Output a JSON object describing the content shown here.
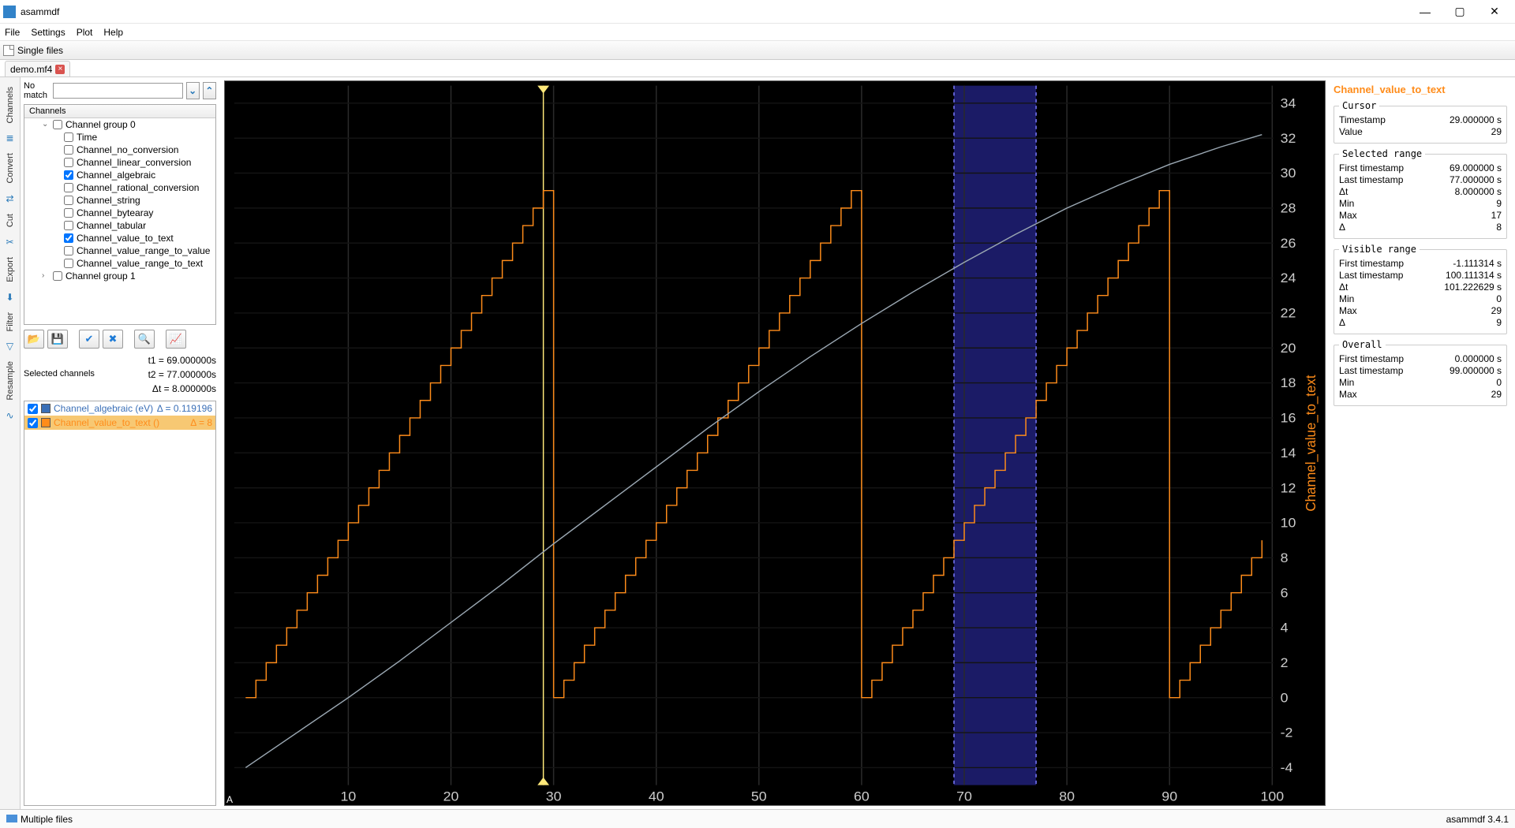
{
  "window": {
    "title": "asammdf"
  },
  "menu": [
    "File",
    "Settings",
    "Plot",
    "Help"
  ],
  "filetab": {
    "label": "Single files"
  },
  "doctab": {
    "label": "demo.mf4"
  },
  "sidetabs": [
    "Channels",
    "Convert",
    "Cut",
    "Export",
    "Filter",
    "Resample"
  ],
  "search": {
    "nomatch": "No match",
    "value": ""
  },
  "tree": {
    "header": "Channels",
    "group0": {
      "label": "Channel group 0",
      "items": [
        {
          "label": "Time",
          "checked": false
        },
        {
          "label": "Channel_no_conversion",
          "checked": false
        },
        {
          "label": "Channel_linear_conversion",
          "checked": false
        },
        {
          "label": "Channel_algebraic",
          "checked": true
        },
        {
          "label": "Channel_rational_conversion",
          "checked": false
        },
        {
          "label": "Channel_string",
          "checked": false
        },
        {
          "label": "Channel_bytearay",
          "checked": false
        },
        {
          "label": "Channel_tabular",
          "checked": false
        },
        {
          "label": "Channel_value_to_text",
          "checked": true
        },
        {
          "label": "Channel_value_range_to_value",
          "checked": false
        },
        {
          "label": "Channel_value_range_to_text",
          "checked": false
        }
      ]
    },
    "group1": {
      "label": "Channel group 1"
    }
  },
  "timestats": {
    "t1": "t1 = 69.000000s",
    "t2": "t2 = 77.000000s",
    "dt": "Δt = 8.000000s"
  },
  "selch_label": "Selected channels",
  "selected_channels": [
    {
      "name": "Channel_algebraic (eV)",
      "color": "#3a6fb7",
      "delta": "Δ = 0.119196",
      "textcolor": "#3a6fb7",
      "hl": false
    },
    {
      "name": "Channel_value_to_text ()",
      "color": "#ff8c1a",
      "delta": "Δ = 8",
      "textcolor": "#ff8c1a",
      "hl": true
    }
  ],
  "right": {
    "channel_name": "Channel_value_to_text",
    "cursor": {
      "Timestamp": "29.000000 s",
      "Value": "29"
    },
    "selected_range": {
      "First timestamp": "69.000000 s",
      "Last timestamp": "77.000000 s",
      "Δt": "8.000000 s",
      "Min": "9",
      "Max": "17",
      "Δ": "8"
    },
    "visible_range": {
      "First timestamp": "-1.111314 s",
      "Last timestamp": "100.111314 s",
      "Δt": "101.222629 s",
      "Min": "0",
      "Max": "29",
      "Δ": "9"
    },
    "overall": {
      "First timestamp": "0.000000 s",
      "Last timestamp": "99.000000 s",
      "Min": "0",
      "Max": "29"
    }
  },
  "statusbar": {
    "left": "Multiple files",
    "right": "asammdf 3.4.1"
  },
  "chart_data": {
    "type": "line",
    "title": "",
    "xlabel": "",
    "ylabel": "",
    "xlim": [
      -1.111314,
      100.111314
    ],
    "ylim": [
      -5,
      35
    ],
    "x_ticks": [
      10,
      20,
      30,
      40,
      50,
      60,
      70,
      80,
      90,
      100
    ],
    "y_ticks": [
      -4,
      -2,
      0,
      2,
      4,
      6,
      8,
      10,
      12,
      14,
      16,
      18,
      20,
      22,
      24,
      26,
      28,
      30,
      32,
      34
    ],
    "cursor_x": 29,
    "selection_x": [
      69,
      77
    ],
    "y_axis_label_vertical": "Channel_value_to_text",
    "series": [
      {
        "name": "Channel_value_to_text",
        "color": "#ff8c1a",
        "step": true,
        "note": "Sawtooth 0..29 repeating every 30s; first ramp continues past 29 (clipped)",
        "x": [
          0,
          1,
          2,
          3,
          4,
          5,
          6,
          7,
          8,
          9,
          10,
          11,
          12,
          13,
          14,
          15,
          16,
          17,
          18,
          19,
          20,
          21,
          22,
          23,
          24,
          25,
          26,
          27,
          28,
          29,
          30,
          31,
          32,
          33,
          34,
          35,
          36,
          37,
          38,
          39,
          40,
          41,
          42,
          43,
          44,
          45,
          46,
          47,
          48,
          49,
          50,
          51,
          52,
          53,
          54,
          55,
          56,
          57,
          58,
          59,
          60,
          61,
          62,
          63,
          64,
          65,
          66,
          67,
          68,
          69,
          70,
          71,
          72,
          73,
          74,
          75,
          76,
          77,
          78,
          79,
          80,
          81,
          82,
          83,
          84,
          85,
          86,
          87,
          88,
          89,
          90,
          91,
          92,
          93,
          94,
          95,
          96,
          97,
          98,
          99
        ],
        "y": [
          0,
          1,
          2,
          3,
          4,
          5,
          6,
          7,
          8,
          9,
          10,
          11,
          12,
          13,
          14,
          15,
          16,
          17,
          18,
          19,
          20,
          21,
          22,
          23,
          24,
          25,
          26,
          27,
          28,
          29,
          0,
          1,
          2,
          3,
          4,
          5,
          6,
          7,
          8,
          9,
          10,
          11,
          12,
          13,
          14,
          15,
          16,
          17,
          18,
          19,
          20,
          21,
          22,
          23,
          24,
          25,
          26,
          27,
          28,
          29,
          0,
          1,
          2,
          3,
          4,
          5,
          6,
          7,
          8,
          9,
          10,
          11,
          12,
          13,
          14,
          15,
          16,
          17,
          18,
          19,
          20,
          21,
          22,
          23,
          24,
          25,
          26,
          27,
          28,
          29,
          0,
          1,
          2,
          3,
          4,
          5,
          6,
          7,
          8,
          9
        ]
      },
      {
        "name": "Channel_algebraic",
        "color": "#9aa7b2",
        "step": false,
        "x": [
          0,
          5,
          10,
          15,
          20,
          25,
          30,
          35,
          40,
          45,
          50,
          55,
          60,
          65,
          70,
          75,
          80,
          85,
          90,
          95,
          99
        ],
        "y": [
          -4.0,
          -2.0,
          0.0,
          2.1,
          4.3,
          6.5,
          8.8,
          11.0,
          13.2,
          15.4,
          17.5,
          19.5,
          21.4,
          23.2,
          24.9,
          26.5,
          28.0,
          29.3,
          30.5,
          31.5,
          32.2
        ]
      }
    ]
  }
}
